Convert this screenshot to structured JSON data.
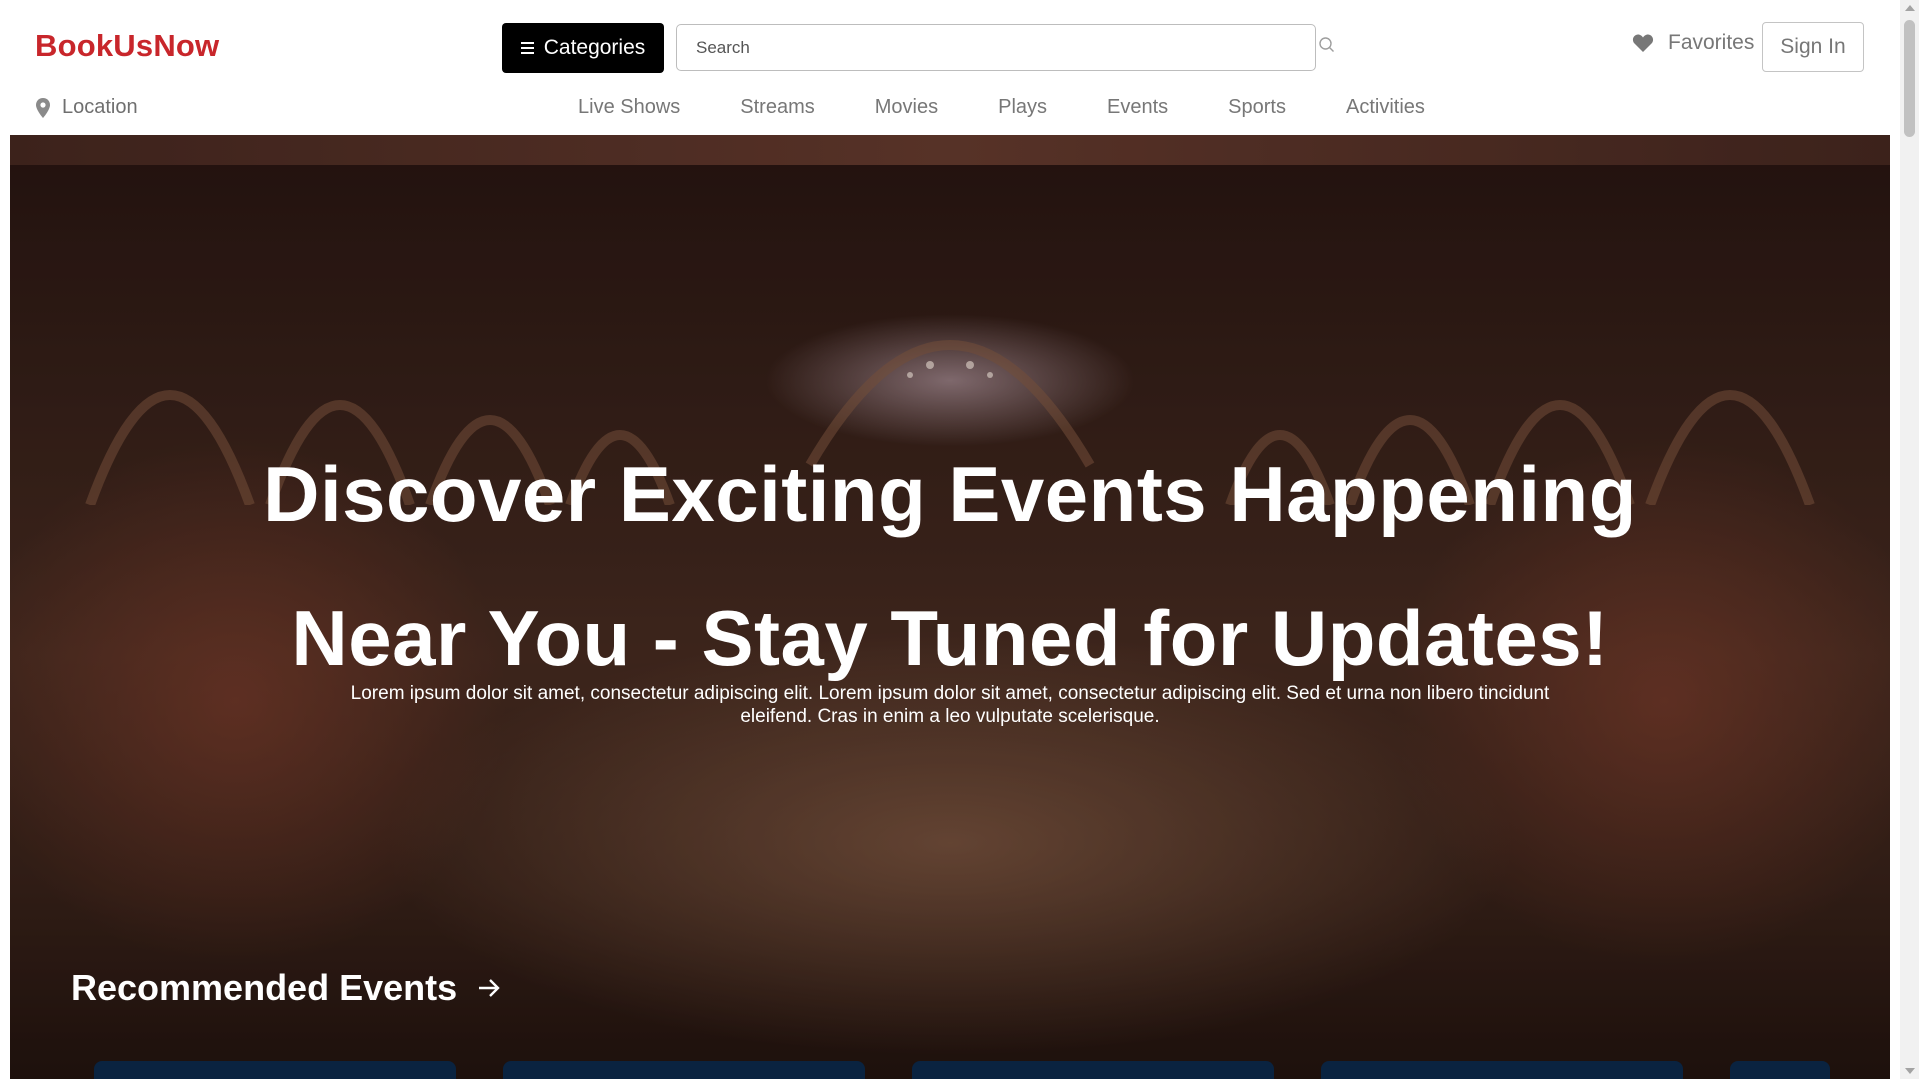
{
  "header": {
    "logo": "BookUsNow",
    "categories_label": "Categories",
    "search_placeholder": "Search",
    "favorites_label": "Favorites",
    "signin_label": "Sign In",
    "location_label": "Location"
  },
  "nav": {
    "items": [
      {
        "label": "Live Shows"
      },
      {
        "label": "Streams"
      },
      {
        "label": "Movies"
      },
      {
        "label": "Plays"
      },
      {
        "label": "Events"
      },
      {
        "label": "Sports"
      },
      {
        "label": "Activities"
      }
    ]
  },
  "hero": {
    "title_line1": "Discover Exciting Events Happening",
    "title_line2": "Near You - Stay Tuned for Updates!",
    "description": "Lorem ipsum dolor sit amet, consectetur adipiscing elit. Lorem ipsum dolor sit amet, consectetur adipiscing elit. Sed et urna non libero tincidunt eleifend. Cras in enim a leo vulputate scelerisque.",
    "recommended_label": "Recommended Events"
  },
  "colors": {
    "brand": "#c8262b",
    "categories_bg": "#000000",
    "nav_text": "#777777",
    "card_bg": "#0a2340"
  },
  "icons": {
    "menu": "hamburger-icon",
    "search": "search-icon",
    "favorites": "heart-icon",
    "location": "location-pin-icon",
    "recommended": "arrow-right-icon"
  }
}
